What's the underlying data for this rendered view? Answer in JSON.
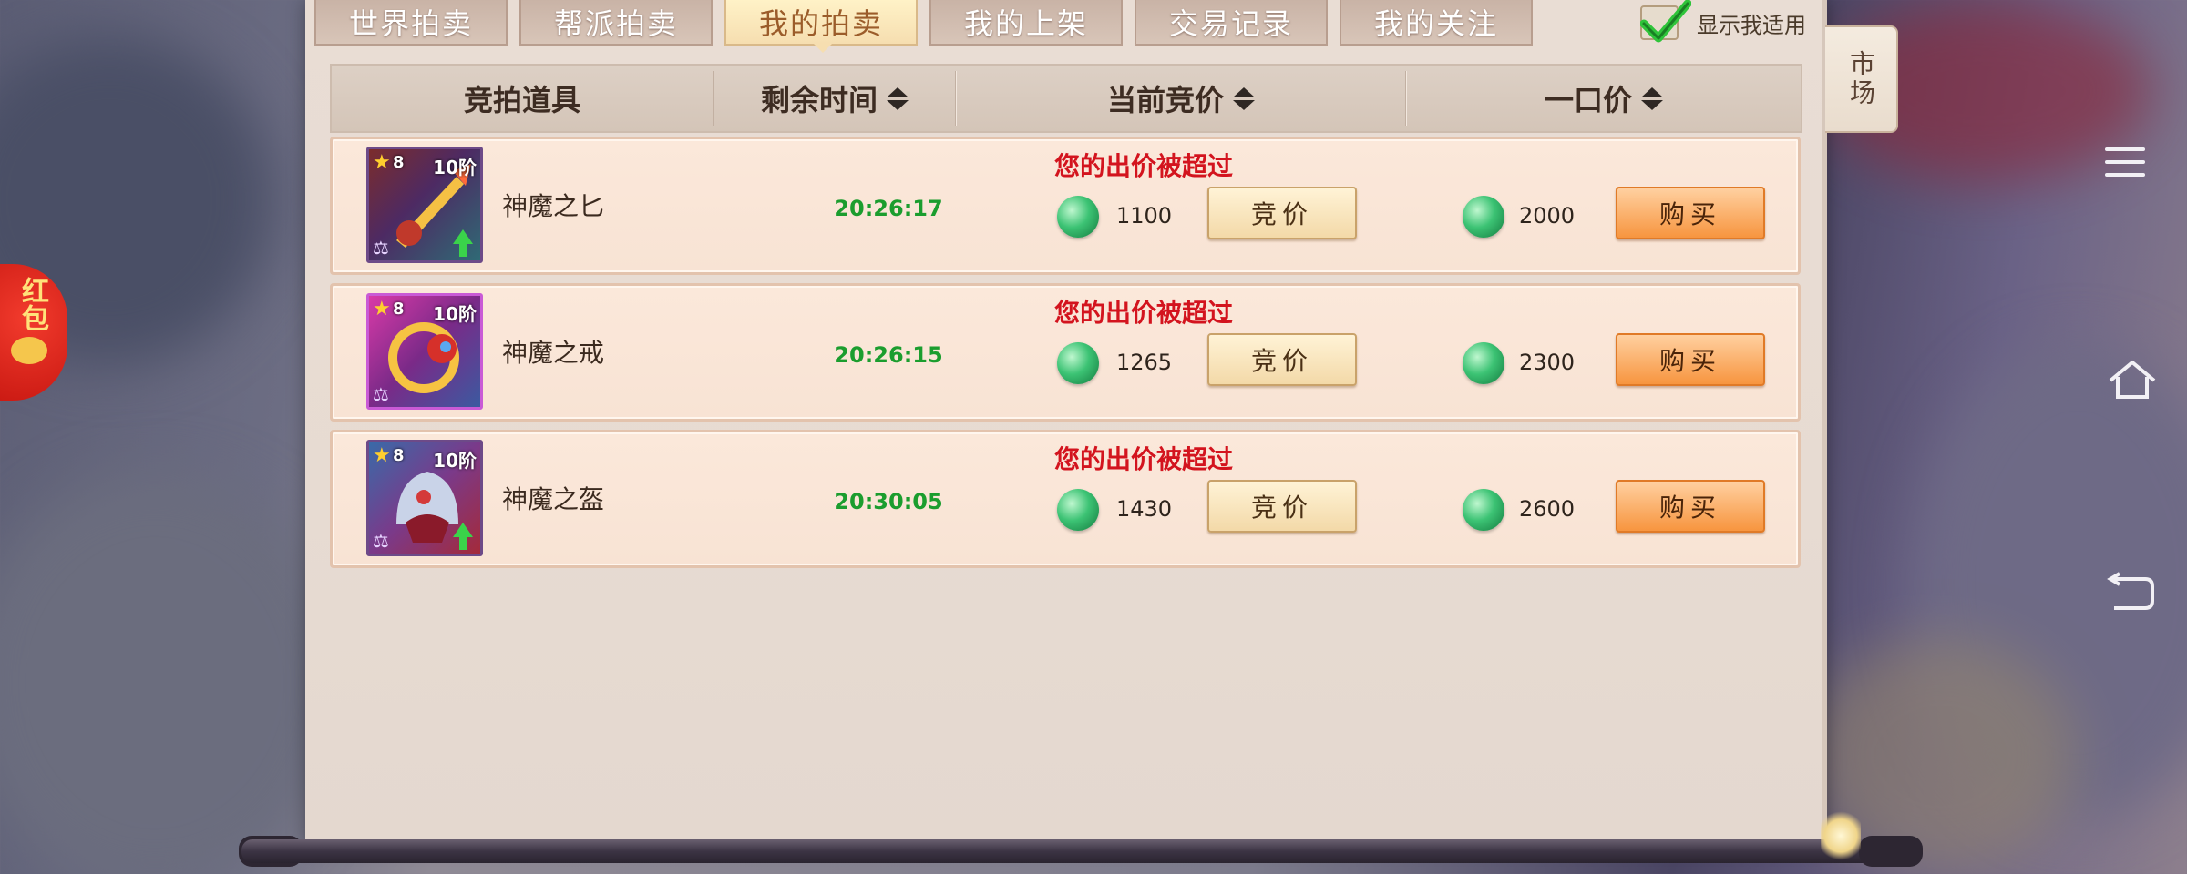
{
  "tabs": [
    "世界拍卖",
    "帮派拍卖",
    "我的拍卖",
    "我的上架",
    "交易记录",
    "我的关注"
  ],
  "active_tab": "我的拍卖",
  "filter": {
    "label": "显示我适用",
    "checked": true
  },
  "side_tab": "市场",
  "red_packet": "红包",
  "columns": {
    "item": "竞拍道具",
    "time": "剩余时间",
    "bid": "当前竞价",
    "buyout": "一口价"
  },
  "rows": [
    {
      "name": "神魔之匕",
      "stars": "8",
      "tier": "10阶",
      "time_left": "20:26:17",
      "status": "您的出价被超过",
      "current_bid": "1100",
      "bid_label": "竞价",
      "buyout": "2000",
      "buy_label": "购买"
    },
    {
      "name": "神魔之戒",
      "stars": "8",
      "tier": "10阶",
      "time_left": "20:26:15",
      "status": "您的出价被超过",
      "current_bid": "1265",
      "bid_label": "竞价",
      "buyout": "2300",
      "buy_label": "购买"
    },
    {
      "name": "神魔之盔",
      "stars": "8",
      "tier": "10阶",
      "time_left": "20:30:05",
      "status": "您的出价被超过",
      "current_bid": "1430",
      "bid_label": "竞价",
      "buyout": "2600",
      "buy_label": "购买"
    }
  ],
  "colors": {
    "time_green": "#1b9d2e",
    "outbid_red": "#d3141e",
    "buy_orange": "#f7953f"
  }
}
